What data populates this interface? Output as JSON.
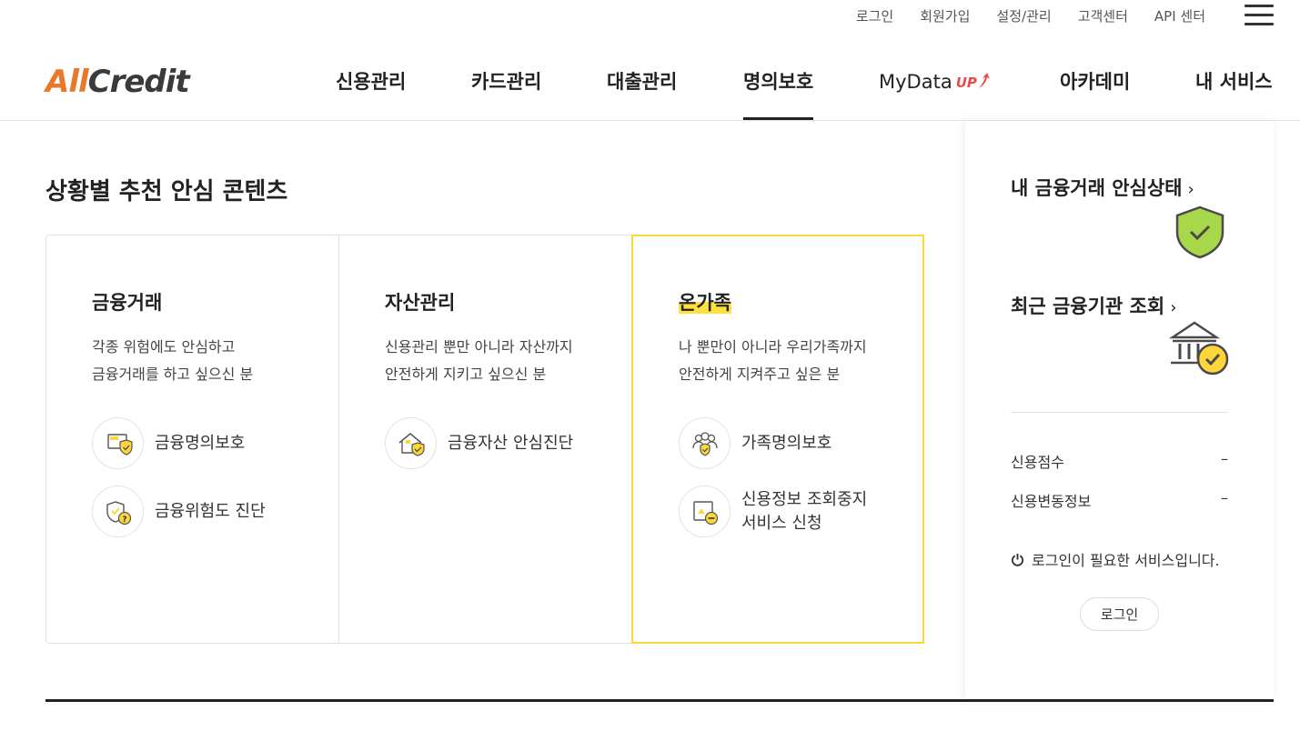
{
  "util": {
    "links": [
      "로그인",
      "회원가입",
      "설정/관리",
      "고객센터",
      "API 센터"
    ]
  },
  "logo": {
    "all": "All",
    "credit": "Credit"
  },
  "gnb": {
    "items": [
      "신용관리",
      "카드관리",
      "대출관리",
      "명의보호",
      "MyData",
      "아카데미",
      "내 서비스"
    ],
    "mydata_badge": "UP",
    "active": "명의보호"
  },
  "section": {
    "title": "상황별 추천 안심 콘텐츠"
  },
  "cards": [
    {
      "title": "금융거래",
      "desc1": "각종 위험에도 안심하고",
      "desc2": "금융거래를 하고 싶으신 분",
      "links": [
        {
          "label": "금융명의보호",
          "icon": "card-shield-icon"
        },
        {
          "label": "금융위험도 진단",
          "icon": "shield-warning-icon"
        }
      ]
    },
    {
      "title": "자산관리",
      "desc1": "신용관리 뿐만 아니라 자산까지",
      "desc2": "안전하게 지키고 싶으신 분",
      "links": [
        {
          "label": "금융자산 안심진단",
          "icon": "house-shield-icon"
        }
      ]
    },
    {
      "title": "온가족",
      "desc1": "나 뿐만이 아니라 우리가족까지",
      "desc2": "안전하게 지켜주고 싶은 분",
      "links": [
        {
          "label": "가족명의보호",
          "icon": "family-shield-icon"
        },
        {
          "label_line1": "신용정보 조회중지",
          "label_line2": "서비스 신청",
          "icon": "document-block-icon"
        }
      ]
    }
  ],
  "side": {
    "safety_link": "내 금융거래 안심상태",
    "institution_link": "최근 금융기관 조회",
    "arrow": "›",
    "credit_score_label": "신용점수",
    "credit_score_value": "–",
    "credit_change_label": "신용변동정보",
    "credit_change_value": "–",
    "notice": "로그인이 필요한 서비스입니다.",
    "login_button": "로그인"
  },
  "colors": {
    "accent_yellow": "#ffd63a",
    "logo_orange": "#e8792b",
    "shield_green": "#a8d84a",
    "up_red": "#e64b4b"
  }
}
